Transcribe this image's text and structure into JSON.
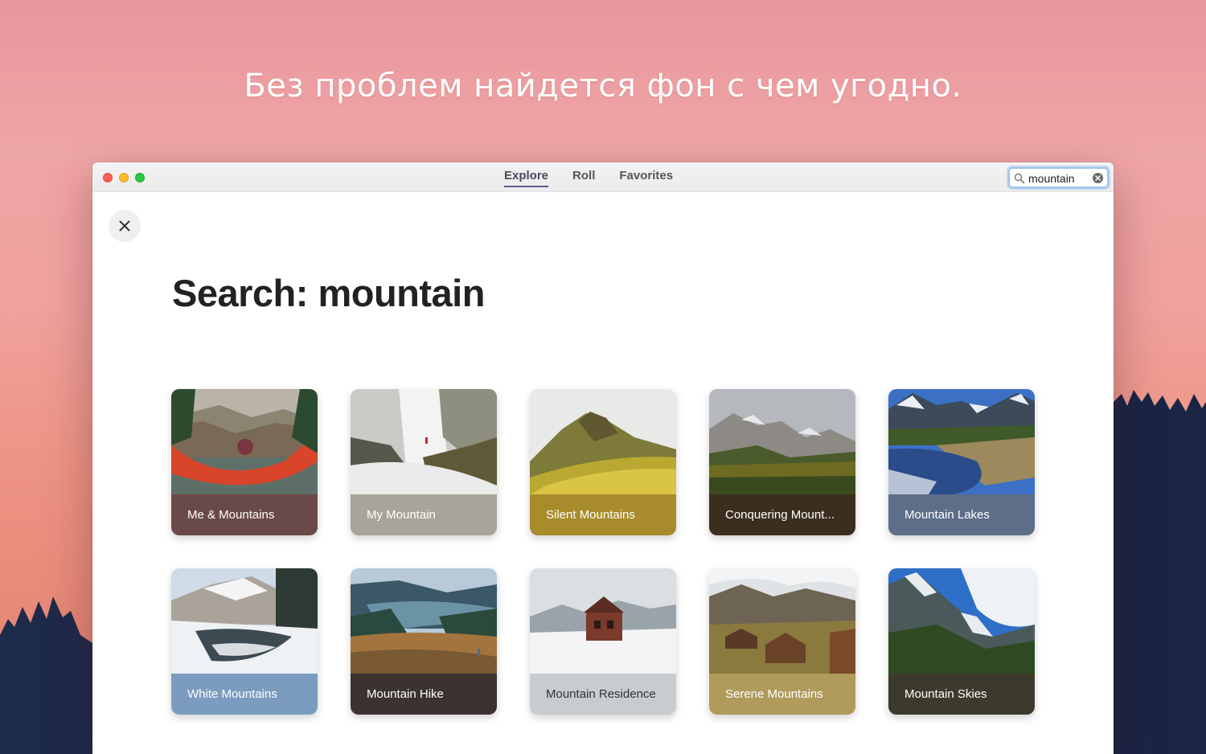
{
  "headline": "Без проблем найдется фон с чем угодно.",
  "window": {
    "tabs": [
      {
        "label": "Explore",
        "active": true
      },
      {
        "label": "Roll",
        "active": false
      },
      {
        "label": "Favorites",
        "active": false
      }
    ],
    "search": {
      "value": "mountain",
      "icon": "search-icon",
      "clear_icon": "clear-icon"
    },
    "close_icon": "close-icon"
  },
  "page_title": "Search: mountain",
  "results": [
    {
      "label": "Me & Mountains",
      "color": "#6a4a48"
    },
    {
      "label": "My Mountain",
      "color": "#a8a49a"
    },
    {
      "label": "Silent Mountains",
      "color": "#a88c2c"
    },
    {
      "label": "Conquering Mount...",
      "color": "#3c2e1e"
    },
    {
      "label": "Mountain Lakes",
      "color": "#5c6e88"
    },
    {
      "label": "White Mountains",
      "color": "#7b9cbf"
    },
    {
      "label": "Mountain Hike",
      "color": "#3c3232"
    },
    {
      "label": "Mountain Residence",
      "color": "#c8ccd0"
    },
    {
      "label": "Serene Mountains",
      "color": "#b09a5c"
    },
    {
      "label": "Mountain Skies",
      "color": "#3c3a2c"
    }
  ]
}
